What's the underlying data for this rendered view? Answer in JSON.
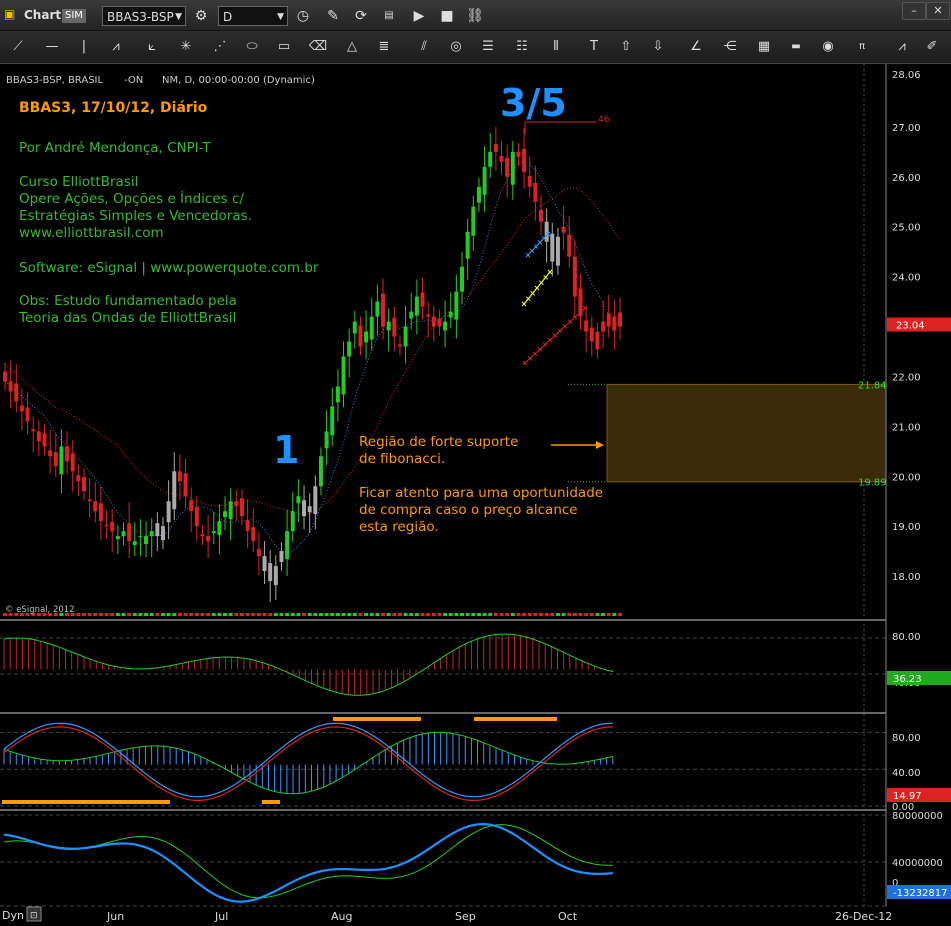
{
  "window": {
    "title": "Chart",
    "sim_badge": "SIM",
    "symbol": "BBAS3-BSP",
    "interval": "D"
  },
  "info_line": {
    "symbol": "BBAS3-BSP, BRASIL",
    "status": "-ON",
    "session": "NM, D, 00:00-00:00 (Dynamic)"
  },
  "annotations": {
    "title": "BBAS3, 17/10/12, Diário",
    "author": "Por André Mendonça, CNPI-T",
    "course": [
      "Curso ElliottBrasil",
      "Opere Ações, Opções e Índices c/",
      "Estratégias Simples e Vencedoras.",
      "www.elliottbrasil.com"
    ],
    "software": "Software: eSignal | www.powerquote.com.br",
    "obs": [
      "Obs: Estudo fundamentado pela",
      "Teoria das Ondas de ElliottBrasil"
    ],
    "wave_1": "1",
    "wave_35": "3/5",
    "wave_count": "46",
    "support": [
      "Região de forte suporte",
      "de fibonacci."
    ],
    "advice": [
      "Ficar atento para uma oportunidade",
      "de compra caso o preço alcance",
      "esta região."
    ],
    "copyright": "© eSignal, 2012"
  },
  "colors": {
    "up": "#22cc22",
    "down": "#dd2222",
    "neutral": "#aaaaaa",
    "annotation_orange": "#ff9900",
    "wave_blue": "#1e90ff",
    "text_green": "#33bb33",
    "zone_fill": "#3a2a08"
  },
  "chart_data": [
    {
      "type": "candlestick",
      "title": "BBAS3, 17/10/12, Diário",
      "x_labels": [
        "Jun",
        "Jul",
        "Aug",
        "Sep",
        "Oct",
        "26-Dec-12"
      ],
      "ylim": [
        17.2,
        28.1
      ],
      "y_ticks": [
        "28.06",
        "27.00",
        "26.00",
        "25.00",
        "24.00",
        "23.00",
        "22.00",
        "21.00",
        "20.00",
        "19.00",
        "18.00"
      ],
      "last_price": "23.04",
      "support_zone": {
        "low": 19.89,
        "high": 21.84,
        "low_label": "19.89",
        "high_label": "21.84"
      },
      "closes": [
        21.9,
        21.7,
        21.5,
        21.3,
        21.1,
        20.9,
        20.7,
        20.6,
        20.4,
        20.2,
        20.6,
        20.3,
        20.1,
        19.9,
        19.7,
        19.5,
        19.3,
        19.1,
        19.0,
        18.9,
        18.8,
        18.9,
        18.7,
        18.7,
        18.8,
        18.8,
        18.9,
        18.8,
        19.0,
        19.5,
        20.1,
        19.9,
        19.6,
        19.3,
        19.0,
        18.8,
        18.7,
        18.9,
        19.1,
        19.3,
        19.5,
        19.4,
        19.2,
        18.9,
        18.7,
        18.4,
        18.1,
        17.9,
        18.2,
        18.5,
        18.9,
        19.3,
        19.6,
        19.2,
        19.4,
        19.8,
        20.4,
        20.9,
        21.4,
        21.8,
        22.4,
        22.7,
        23.1,
        22.6,
        22.9,
        23.2,
        23.5,
        23.0,
        23.1,
        22.8,
        22.6,
        23.0,
        23.3,
        23.6,
        23.4,
        23.2,
        23.0,
        23.0,
        23.1,
        23.3,
        23.7,
        24.2,
        24.9,
        25.4,
        25.8,
        26.2,
        26.5,
        26.5,
        26.3,
        26.0,
        26.5,
        26.4,
        26.1,
        25.8,
        25.5,
        25.1,
        24.7,
        24.3,
        24.8,
        25.0,
        24.4,
        23.6,
        23.2,
        22.9,
        22.7,
        22.9,
        23.1,
        23.0,
        23.2,
        23.0
      ]
    },
    {
      "type": "line",
      "name_hint": "oscillator 1",
      "ylim": [
        0,
        100
      ],
      "y_ticks": [
        "80.00",
        "40.00"
      ],
      "last_value": "36.23"
    },
    {
      "type": "line",
      "name_hint": "stochastic",
      "ylim": [
        0,
        100
      ],
      "y_ticks": [
        "80.00",
        "40.00",
        "0.00"
      ],
      "last_value": "14.97"
    },
    {
      "type": "line",
      "name_hint": "volume indicator",
      "y_ticks": [
        "80000000",
        "40000000",
        "0"
      ],
      "last_value": "-13232817"
    }
  ],
  "footer": {
    "mode": "Dyn"
  }
}
